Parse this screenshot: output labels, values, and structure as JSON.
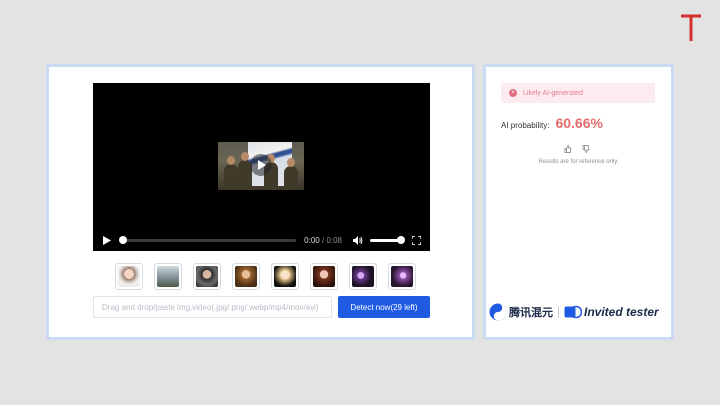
{
  "video": {
    "current_time": "0:00",
    "duration": "/ 0:08",
    "progress": 0.0,
    "volume": 1.0
  },
  "thumbnails": [
    "thumb-1",
    "thumb-2",
    "thumb-3",
    "thumb-4",
    "thumb-5",
    "thumb-6",
    "thumb-7",
    "thumb-8"
  ],
  "upload": {
    "placeholder": "Drag and drop/paste img,video(.jpg/.png/.webp/mp4/mov/avi)",
    "detect_label": "Detect now(29 left)"
  },
  "result": {
    "status": "Likely AI-generated",
    "probability_label": "AI probability:",
    "probability_value": "60.66%",
    "disclaimer": "Results are for reference only."
  },
  "branding": {
    "name": "腾讯混元",
    "tag": "Invited tester"
  },
  "colors": {
    "accent": "#1f5ae3",
    "alert": "#e46b6b",
    "panel_border": "#c9daf2",
    "corner_logo": "#d32f2f"
  }
}
